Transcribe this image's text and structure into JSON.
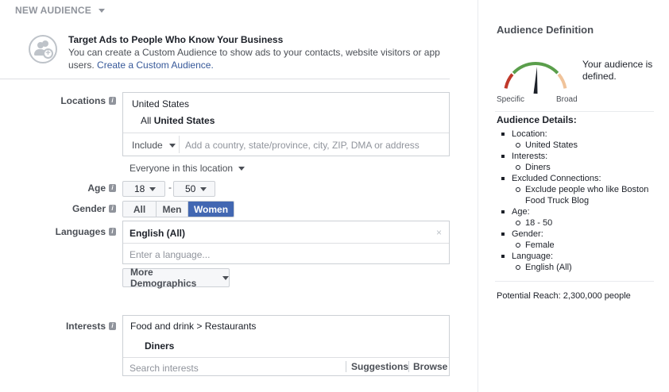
{
  "header": {
    "title": "NEW AUDIENCE"
  },
  "custom_audience": {
    "title": "Target Ads to People Who Know Your Business",
    "desc": "You can create a Custom Audience to show ads to your contacts, website visitors or app users.",
    "link": "Create a Custom Audience."
  },
  "locations": {
    "label": "Locations",
    "country": "United States",
    "all_prefix": "All",
    "all_value": "United States",
    "include_label": "Include",
    "input_placeholder": "Add a country, state/province, city, ZIP, DMA or address",
    "everyone": "Everyone in this location"
  },
  "age": {
    "label": "Age",
    "min": "18",
    "max": "50",
    "sep": "-"
  },
  "gender": {
    "label": "Gender",
    "options": [
      "All",
      "Men",
      "Women"
    ],
    "selected": "Women"
  },
  "languages": {
    "label": "Languages",
    "tag": "English (All)",
    "remove": "×",
    "placeholder": "Enter a language..."
  },
  "more_demographics": {
    "label": "More Demographics"
  },
  "interests": {
    "label": "Interests",
    "path": "Food and drink > Restaurants",
    "item": "Diners",
    "placeholder": "Search interests",
    "suggestions": "Suggestions",
    "browse": "Browse"
  },
  "sidebar": {
    "title": "Audience Definition",
    "gauge_status": "Your audience is defined.",
    "gauge_left": "Specific",
    "gauge_right": "Broad",
    "gauge_level": 0.52,
    "details_title": "Audience Details:",
    "details": [
      {
        "key": "Location:",
        "values": [
          "United States"
        ]
      },
      {
        "key": "Interests:",
        "values": [
          "Diners"
        ]
      },
      {
        "key": "Excluded Connections:",
        "values": [
          "Exclude people who like Boston Food Truck Blog"
        ]
      },
      {
        "key": "Age:",
        "values": [
          "18 - 50"
        ]
      },
      {
        "key": "Gender:",
        "values": [
          "Female"
        ]
      },
      {
        "key": "Language:",
        "values": [
          "English (All)"
        ]
      }
    ],
    "reach": "Potential Reach: 2,300,000 people"
  },
  "colors": {
    "accent": "#4267b2",
    "link": "#365899",
    "gauge_red": "#c0392b",
    "gauge_green": "#5a9e4b",
    "gauge_orange": "#f0c39a"
  }
}
